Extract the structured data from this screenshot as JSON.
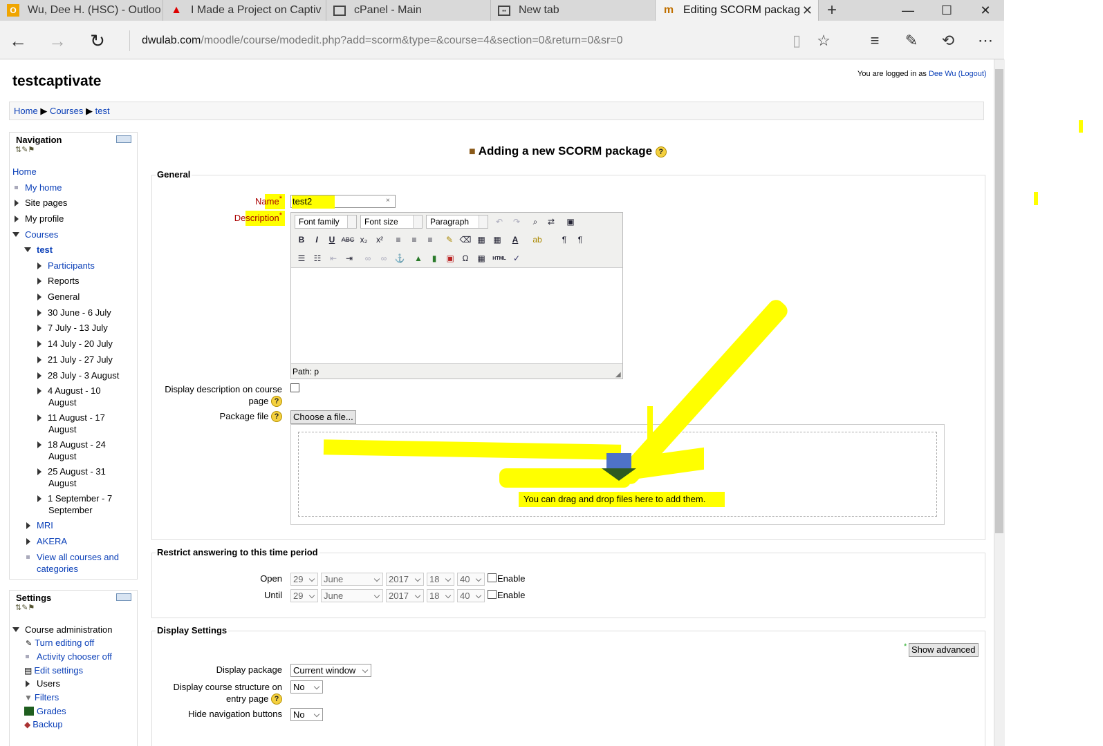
{
  "browser": {
    "tabs": [
      {
        "title": "Wu, Dee H. (HSC) - Outloo",
        "icon": "outlook-icon"
      },
      {
        "title": "I Made a Project on Captiv",
        "icon": "adobe-icon"
      },
      {
        "title": "cPanel - Main",
        "icon": "page-icon"
      },
      {
        "title": "New tab",
        "icon": "newtab-icon"
      },
      {
        "title": "Editing SCORM packag",
        "icon": "moodle-icon",
        "active": true
      }
    ],
    "url_host": "dwulab.com",
    "url_path": "/moodle/course/modedit.php?add=scorm&type=&course=4&section=0&return=0&sr=0"
  },
  "site": {
    "title": "testcaptivate",
    "login_prefix": "You are logged in as ",
    "user": "Dee Wu",
    "logout": "(Logout)",
    "breadcrumb": [
      "Home",
      "Courses",
      "test"
    ],
    "breadcrumb_sep": "▶"
  },
  "navigation": {
    "title": "Navigation",
    "items": [
      {
        "label": "Home"
      },
      {
        "label": "My home"
      },
      {
        "label": "Site pages"
      },
      {
        "label": "My profile"
      },
      {
        "label": "Courses"
      },
      {
        "label": "test"
      },
      {
        "label": "Participants"
      },
      {
        "label": "Reports"
      },
      {
        "label": "General"
      },
      {
        "label": "30 June - 6 July"
      },
      {
        "label": "7 July - 13 July"
      },
      {
        "label": "14 July - 20 July"
      },
      {
        "label": "21 July - 27 July"
      },
      {
        "label": "28 July - 3 August"
      },
      {
        "label": "4 August - 10 August"
      },
      {
        "label": "11 August - 17 August"
      },
      {
        "label": "18 August - 24 August"
      },
      {
        "label": "25 August - 31 August"
      },
      {
        "label": "1 September - 7 September"
      },
      {
        "label": "MRI"
      },
      {
        "label": "AKERA"
      },
      {
        "label": "View all courses and categories"
      }
    ]
  },
  "settings": {
    "title": "Settings",
    "items": [
      {
        "label": "Course administration"
      },
      {
        "label": "Turn editing off"
      },
      {
        "label": "Activity chooser off"
      },
      {
        "label": "Edit settings"
      },
      {
        "label": "Users"
      },
      {
        "label": "Filters"
      },
      {
        "label": "Grades"
      },
      {
        "label": "Backup"
      }
    ]
  },
  "form": {
    "heading": "Adding a new SCORM package",
    "general_legend": "General",
    "name_label": "Name",
    "name_value": "test2",
    "description_label": "Description",
    "editor": {
      "font_family": "Font family",
      "font_size": "Font size",
      "paragraph": "Paragraph",
      "path": "Path: p"
    },
    "display_desc_label": "Display description on course page",
    "package_file_label": "Package file",
    "choose_file": "Choose a file...",
    "drop_hint": "You can drag and drop files here to add them.",
    "restrict_legend": "Restrict answering to this time period",
    "open_label": "Open",
    "until_label": "Until",
    "date": {
      "day": "29",
      "month": "June",
      "year": "2017",
      "hour": "18",
      "minute": "40"
    },
    "enable_label": "Enable",
    "display_legend": "Display Settings",
    "show_advanced": "Show advanced",
    "display_package_label": "Display package",
    "display_package_value": "Current window",
    "course_structure_label": "Display course structure on entry page",
    "course_structure_value": "No",
    "hide_nav_label": "Hide navigation buttons",
    "hide_nav_value": "No"
  },
  "colors": {
    "link": "#0a3fb8",
    "required": "#aa0000",
    "annotation": "#ffff00"
  }
}
